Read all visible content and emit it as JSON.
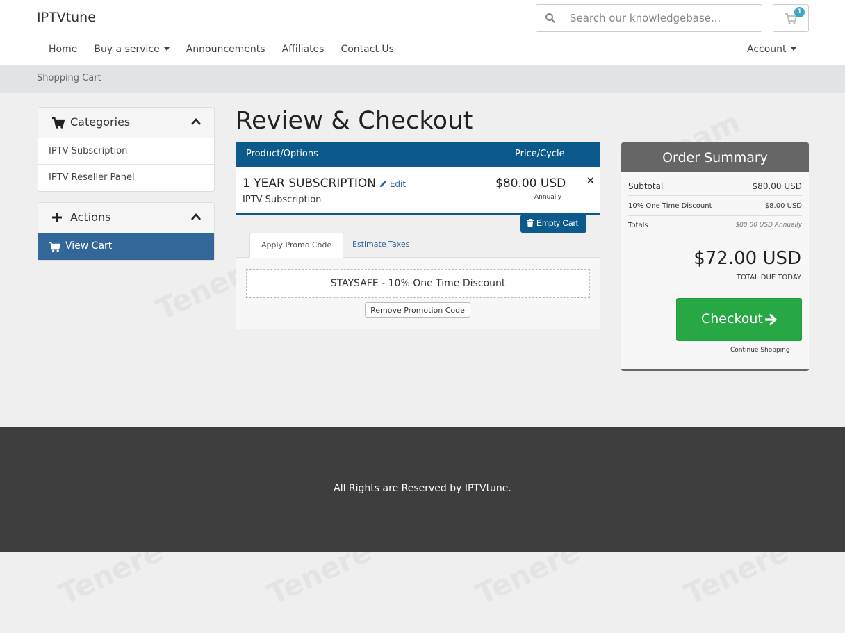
{
  "header": {
    "logo": "IPTVtune",
    "search_placeholder": "Search our knowledgebase...",
    "cart_count": "1",
    "nav": [
      "Home",
      "Buy a service",
      "Announcements",
      "Affiliates",
      "Contact Us"
    ],
    "account": "Account"
  },
  "breadcrumb": "Shopping Cart",
  "sidebar": {
    "categories_title": "Categories",
    "categories": [
      "IPTV Subscription",
      "IPTV Reseller Panel"
    ],
    "actions_title": "Actions",
    "actions": [
      "View Cart"
    ]
  },
  "main": {
    "title": "Review & Checkout",
    "col_product": "Product/Options",
    "col_price": "Price/Cycle",
    "item": {
      "name": "1 YEAR SUBSCRIPTION",
      "edit": "Edit",
      "group": "IPTV Subscription",
      "price": "$80.00 USD",
      "cycle": "Annually",
      "remove": "×"
    },
    "empty_cart": "Empty Cart",
    "tabs": [
      "Apply Promo Code",
      "Estimate Taxes"
    ],
    "promo_applied": "STAYSAFE - 10% One Time Discount",
    "remove_promo": "Remove Promotion Code"
  },
  "summary": {
    "title": "Order Summary",
    "subtotal_label": "Subtotal",
    "subtotal_value": "$80.00 USD",
    "discount_label": "10% One Time Discount",
    "discount_value": "$8.00 USD",
    "totals_label": "Totals",
    "totals_value": "$80.00 USD Annually",
    "total_due": "$72.00 USD",
    "total_due_label": "TOTAL DUE TODAY",
    "checkout": "Checkout",
    "continue": "Continue Shopping"
  },
  "footer": "All Rights are Reserved by IPTVtune.",
  "colors": {
    "primary": "#0c5a8c",
    "active_nav": "#336699",
    "checkout": "#28a745",
    "summary_head": "#666666",
    "footer": "#3e3e3e"
  }
}
